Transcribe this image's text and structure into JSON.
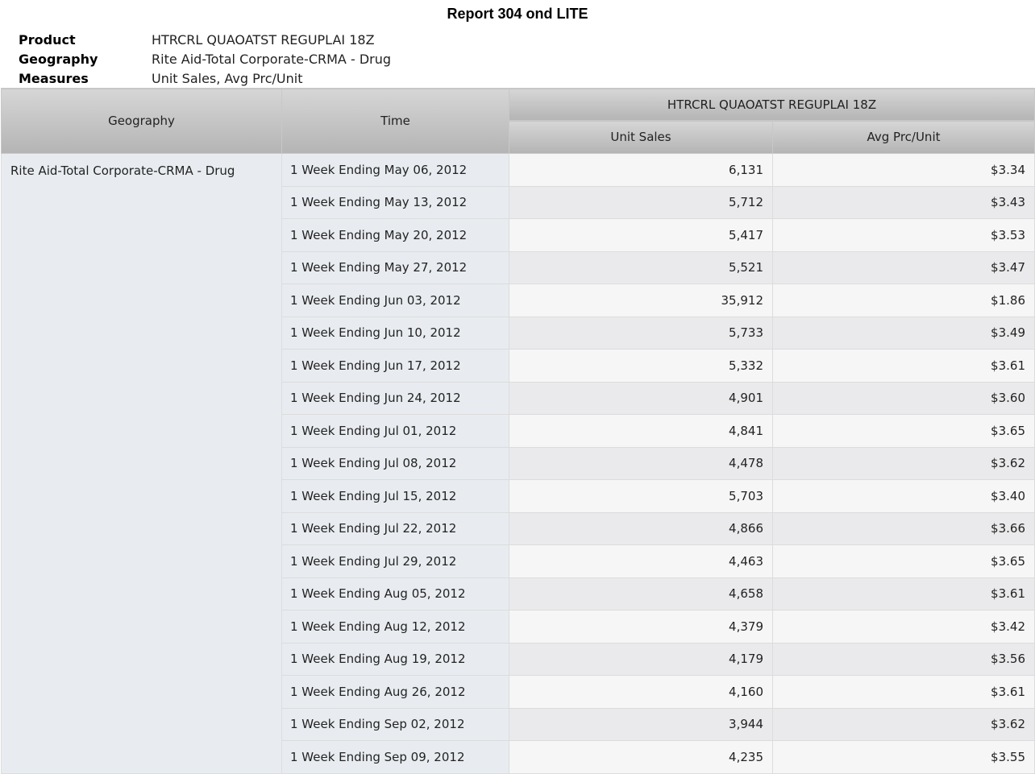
{
  "report": {
    "title": "Report 304 ond LITE"
  },
  "meta": [
    {
      "label": "Product",
      "value": "HTRCRL QUAOATST REGUPLAI 18Z"
    },
    {
      "label": "Geography",
      "value": "Rite Aid-Total Corporate-CRMA - Drug"
    },
    {
      "label": "Measures",
      "value": "Unit Sales, Avg Prc/Unit"
    }
  ],
  "table": {
    "headers": {
      "geography": "Geography",
      "time": "Time",
      "product": "HTRCRL QUAOATST REGUPLAI 18Z",
      "unit_sales": "Unit Sales",
      "avg_price": "Avg Prc/Unit"
    },
    "geography": "Rite Aid-Total Corporate-CRMA - Drug",
    "rows": [
      {
        "time": "1 Week Ending May 06, 2012",
        "unit_sales": "6,131",
        "avg_price": "$3.34"
      },
      {
        "time": "1 Week Ending May 13, 2012",
        "unit_sales": "5,712",
        "avg_price": "$3.43"
      },
      {
        "time": "1 Week Ending May 20, 2012",
        "unit_sales": "5,417",
        "avg_price": "$3.53"
      },
      {
        "time": "1 Week Ending May 27, 2012",
        "unit_sales": "5,521",
        "avg_price": "$3.47"
      },
      {
        "time": "1 Week Ending Jun 03, 2012",
        "unit_sales": "35,912",
        "avg_price": "$1.86"
      },
      {
        "time": "1 Week Ending Jun 10, 2012",
        "unit_sales": "5,733",
        "avg_price": "$3.49"
      },
      {
        "time": "1 Week Ending Jun 17, 2012",
        "unit_sales": "5,332",
        "avg_price": "$3.61"
      },
      {
        "time": "1 Week Ending Jun 24, 2012",
        "unit_sales": "4,901",
        "avg_price": "$3.60"
      },
      {
        "time": "1 Week Ending Jul 01, 2012",
        "unit_sales": "4,841",
        "avg_price": "$3.65"
      },
      {
        "time": "1 Week Ending Jul 08, 2012",
        "unit_sales": "4,478",
        "avg_price": "$3.62"
      },
      {
        "time": "1 Week Ending Jul 15, 2012",
        "unit_sales": "5,703",
        "avg_price": "$3.40"
      },
      {
        "time": "1 Week Ending Jul 22, 2012",
        "unit_sales": "4,866",
        "avg_price": "$3.66"
      },
      {
        "time": "1 Week Ending Jul 29, 2012",
        "unit_sales": "4,463",
        "avg_price": "$3.65"
      },
      {
        "time": "1 Week Ending Aug 05, 2012",
        "unit_sales": "4,658",
        "avg_price": "$3.61"
      },
      {
        "time": "1 Week Ending Aug 12, 2012",
        "unit_sales": "4,379",
        "avg_price": "$3.42"
      },
      {
        "time": "1 Week Ending Aug 19, 2012",
        "unit_sales": "4,179",
        "avg_price": "$3.56"
      },
      {
        "time": "1 Week Ending Aug 26, 2012",
        "unit_sales": "4,160",
        "avg_price": "$3.61"
      },
      {
        "time": "1 Week Ending Sep 02, 2012",
        "unit_sales": "3,944",
        "avg_price": "$3.62"
      },
      {
        "time": "1 Week Ending Sep 09, 2012",
        "unit_sales": "4,235",
        "avg_price": "$3.55"
      }
    ]
  }
}
